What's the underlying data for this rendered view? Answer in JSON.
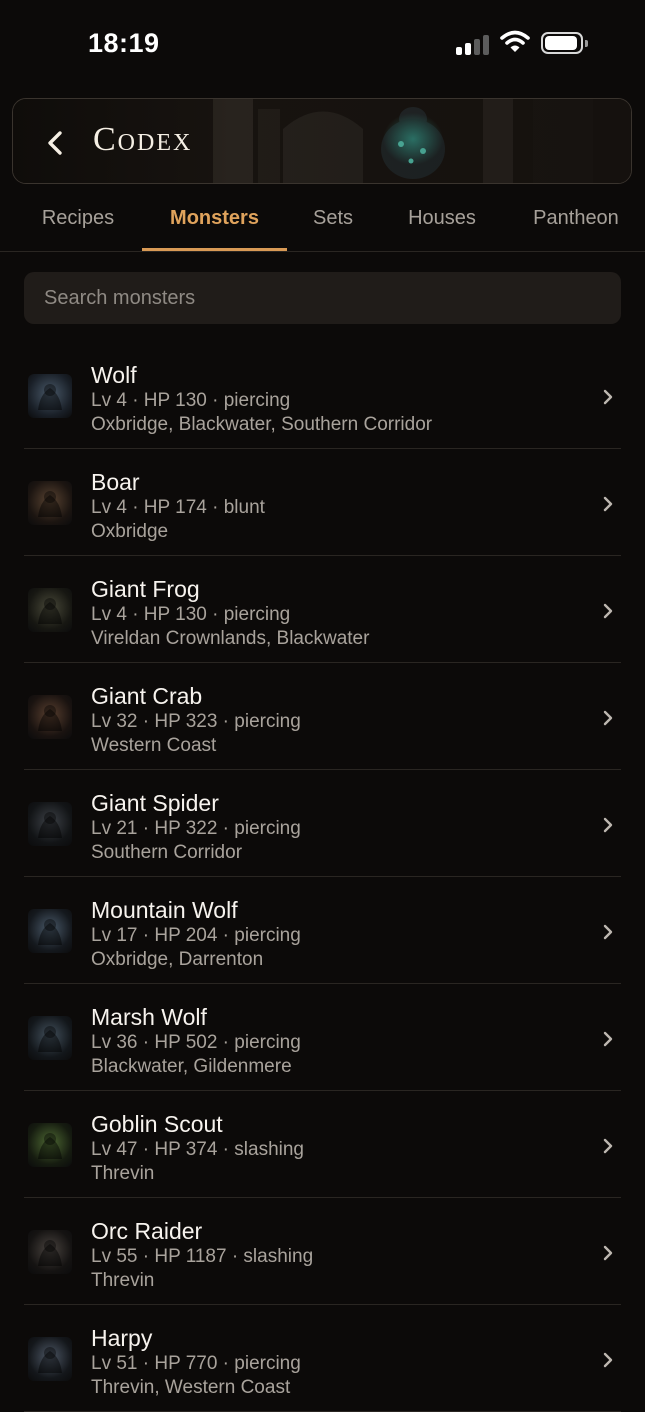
{
  "status_bar": {
    "time": "18:19"
  },
  "header": {
    "title": "Codex"
  },
  "tabs": [
    {
      "label": "Recipes"
    },
    {
      "label": "Monsters"
    },
    {
      "label": "Sets"
    },
    {
      "label": "Houses"
    },
    {
      "label": "Pantheon"
    }
  ],
  "active_tab": "Monsters",
  "search": {
    "placeholder": "Search monsters"
  },
  "monsters": [
    {
      "name": "Wolf",
      "stats": "Lv 4 · HP 130 · piercing",
      "locations": "Oxbridge, Blackwater, Southern Corridor"
    },
    {
      "name": "Boar",
      "stats": "Lv 4 · HP 174 · blunt",
      "locations": "Oxbridge"
    },
    {
      "name": "Giant Frog",
      "stats": "Lv 4 · HP 130 · piercing",
      "locations": "Vireldan Crownlands, Blackwater"
    },
    {
      "name": "Giant Crab",
      "stats": "Lv 32 · HP 323 · piercing",
      "locations": "Western Coast"
    },
    {
      "name": "Giant Spider",
      "stats": "Lv 21 · HP 322 · piercing",
      "locations": "Southern Corridor"
    },
    {
      "name": "Mountain Wolf",
      "stats": "Lv 17 · HP 204 · piercing",
      "locations": "Oxbridge, Darrenton"
    },
    {
      "name": "Marsh Wolf",
      "stats": "Lv 36 · HP 502 · piercing",
      "locations": "Blackwater, Gildenmere"
    },
    {
      "name": "Goblin Scout",
      "stats": "Lv 47 · HP 374 · slashing",
      "locations": "Threvin"
    },
    {
      "name": "Orc Raider",
      "stats": "Lv 55 · HP 1187 · slashing",
      "locations": "Threvin"
    },
    {
      "name": "Harpy",
      "stats": "Lv 51 · HP 770 · piercing",
      "locations": "Threvin, Western Coast"
    }
  ],
  "icons": {
    "back": "chevron-left-icon",
    "row_chevron": "chevron-right-icon",
    "signal": "cellular-signal-icon",
    "wifi": "wifi-icon",
    "battery": "battery-icon"
  },
  "colors": {
    "background": "#0c0a09",
    "accent": "#e0a35c",
    "text_primary": "#f7f3ee",
    "text_secondary": "#a9a39c"
  }
}
